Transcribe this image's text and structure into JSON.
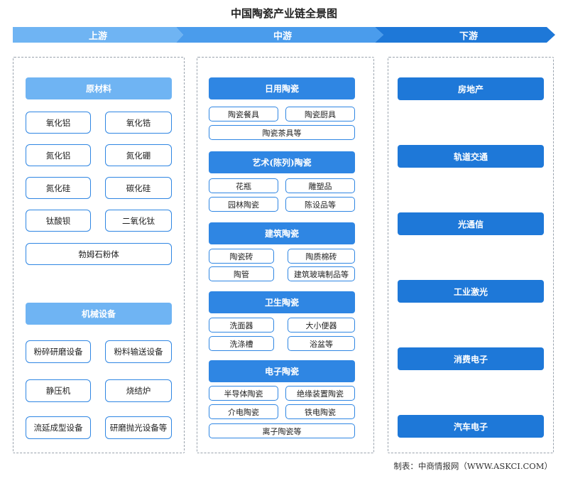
{
  "title": "中国陶瓷产业链全景图",
  "stages": {
    "upstream": "上游",
    "midstream": "中游",
    "downstream": "下游"
  },
  "colors": {
    "arrow_light": "#6fb4f3",
    "arrow_mid": "#4a9cec",
    "arrow_dark": "#1e78d8",
    "border": "#2f86e3"
  },
  "upstream": {
    "raw_materials": {
      "label": "原材料",
      "items": [
        "氧化铝",
        "氧化锆",
        "氮化铝",
        "氮化硼",
        "氮化硅",
        "碳化硅",
        "钛酸钡",
        "二氧化钛",
        "勃姆石粉体"
      ]
    },
    "machinery": {
      "label": "机械设备",
      "items": [
        "粉碎研磨设备",
        "粉料输送设备",
        "静压机",
        "烧结炉",
        "流延成型设备",
        "研磨抛光设备等"
      ]
    }
  },
  "midstream": {
    "daily": {
      "label": "日用陶瓷",
      "items": [
        "陶瓷餐具",
        "陶瓷厨具",
        "陶瓷茶具等"
      ]
    },
    "art": {
      "label": "艺术(陈列)陶瓷",
      "items": [
        "花瓶",
        "雕塑品",
        "园林陶瓷",
        "陈设品等"
      ]
    },
    "building": {
      "label": "建筑陶瓷",
      "items": [
        "陶瓷砖",
        "陶质棉砖",
        "陶管",
        "建筑玻璃制品等"
      ]
    },
    "sanitary": {
      "label": "卫生陶瓷",
      "items": [
        "洗面器",
        "大小便器",
        "洗涤槽",
        "浴盆等"
      ]
    },
    "electronic": {
      "label": "电子陶瓷",
      "items": [
        "半导体陶瓷",
        "绝缘装置陶瓷",
        "介电陶瓷",
        "铁电陶瓷",
        "离子陶瓷等"
      ]
    }
  },
  "downstream": {
    "items": [
      "房地产",
      "轨道交通",
      "光通信",
      "工业激光",
      "消费电子",
      "汽车电子"
    ]
  },
  "footer": "制表：中商情报网（WWW.ASKCI.COM）"
}
